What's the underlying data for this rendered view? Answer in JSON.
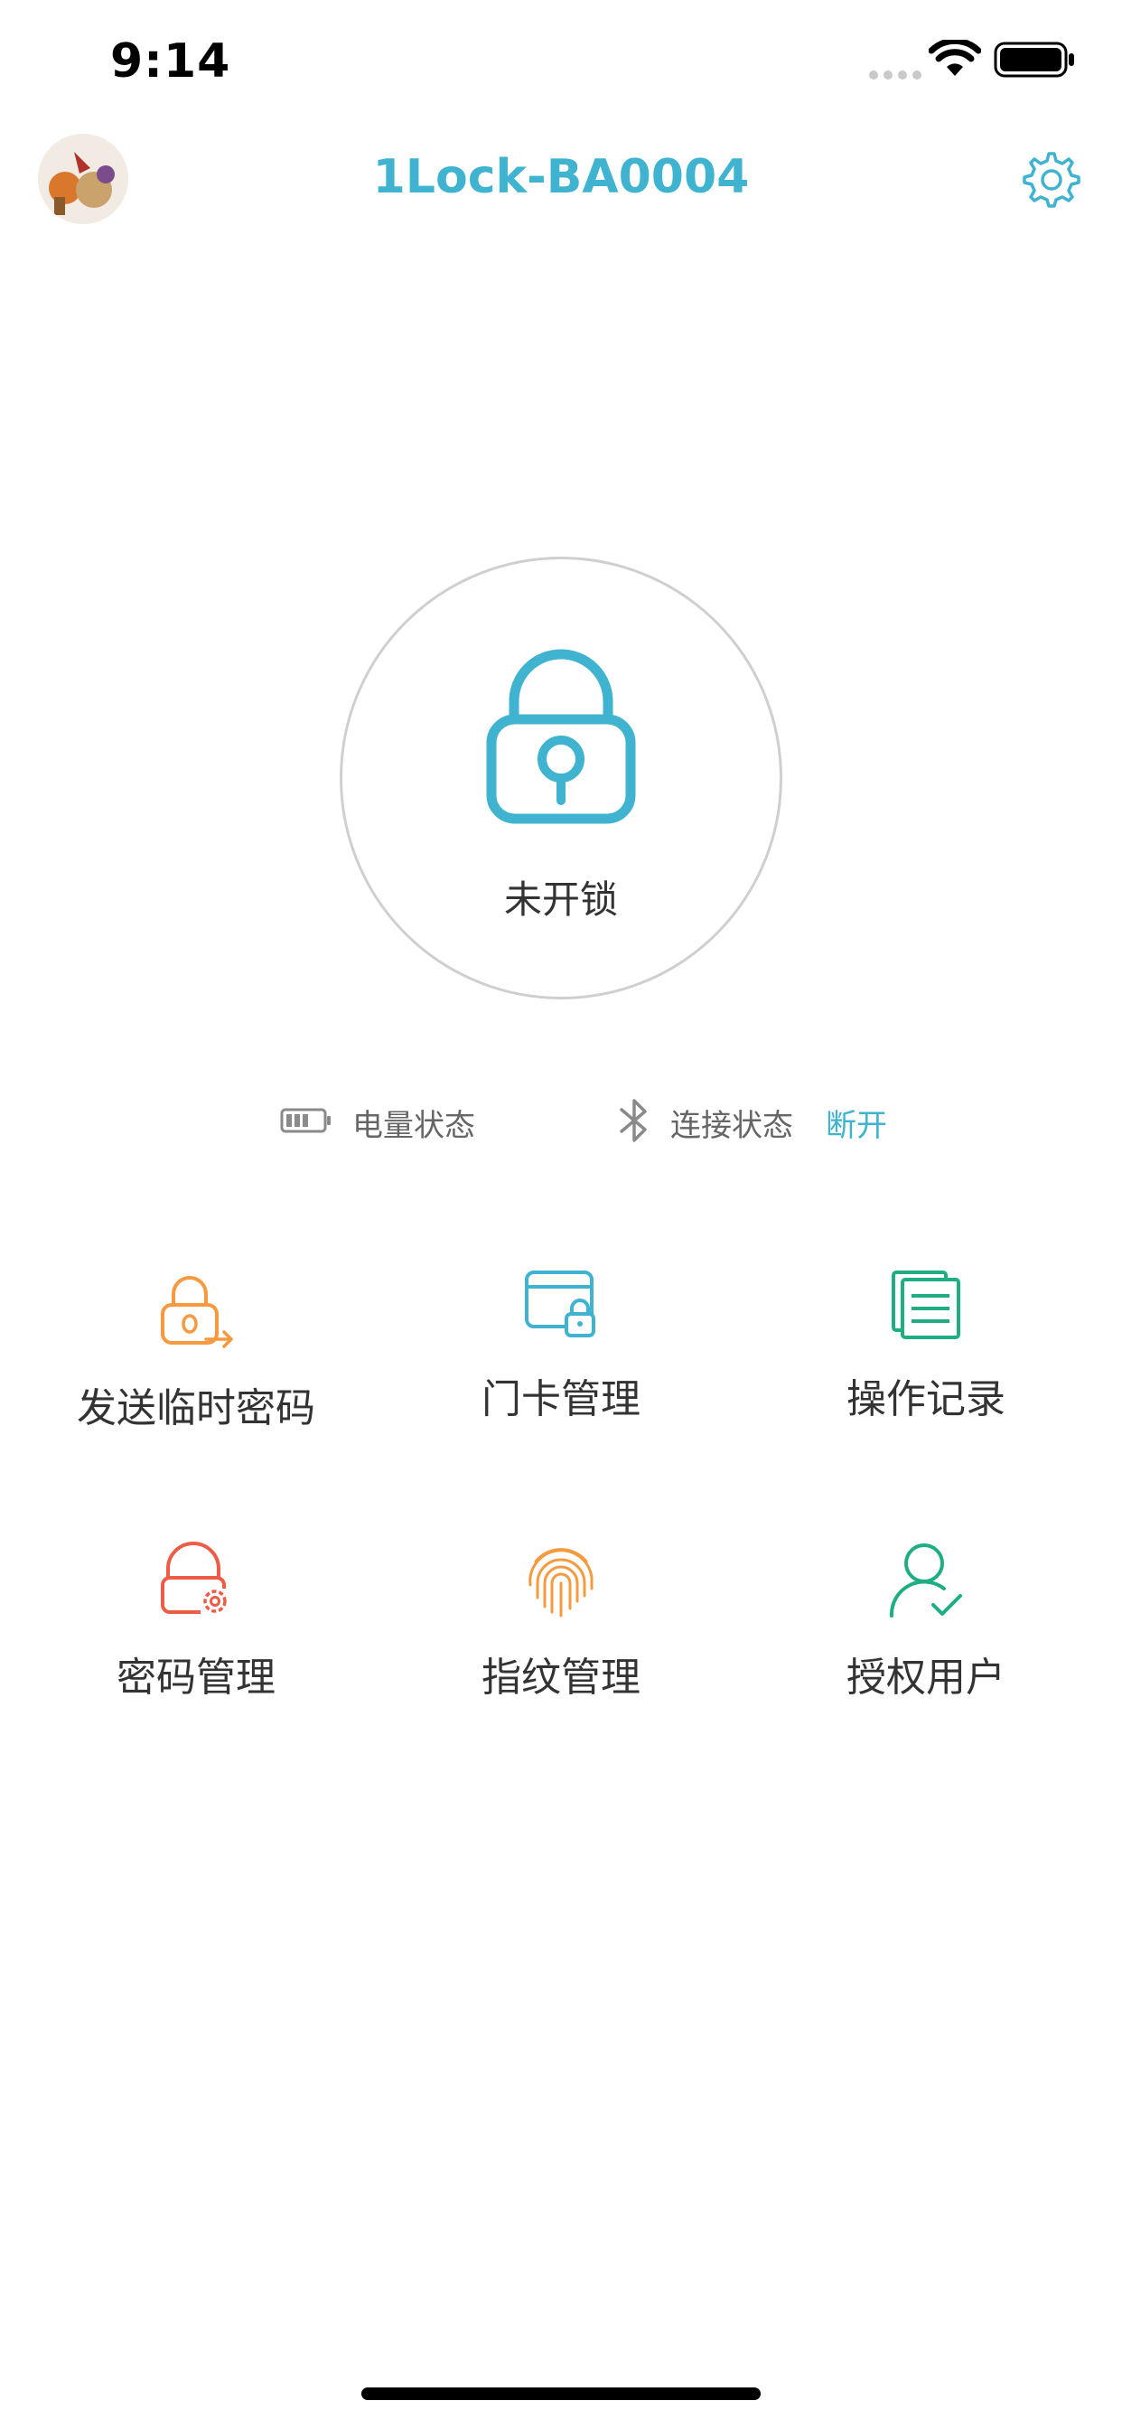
{
  "status_bar": {
    "time": "9:14"
  },
  "header": {
    "title": "1Lock-BA0004",
    "avatar_icon": "avatar-photo",
    "settings_icon": "gear-icon"
  },
  "lock": {
    "status_text": "未开锁",
    "icon": "padlock-icon",
    "accent_color": "#3fb3cf"
  },
  "status_row": {
    "battery_label": "电量状态",
    "connection_label": "连接状态",
    "connection_value": "断开"
  },
  "functions": [
    {
      "label": "发送临时密码",
      "icon": "send-temp-password-icon",
      "color": "#f59a3e"
    },
    {
      "label": "门卡管理",
      "icon": "card-lock-icon",
      "color": "#3fb3cf"
    },
    {
      "label": "操作记录",
      "icon": "records-icon",
      "color": "#1fae84"
    },
    {
      "label": "密码管理",
      "icon": "password-settings-icon",
      "color": "#ee5c45"
    },
    {
      "label": "指纹管理",
      "icon": "fingerprint-icon",
      "color": "#f59a3e"
    },
    {
      "label": "授权用户",
      "icon": "authorized-user-icon",
      "color": "#1fae84"
    }
  ]
}
